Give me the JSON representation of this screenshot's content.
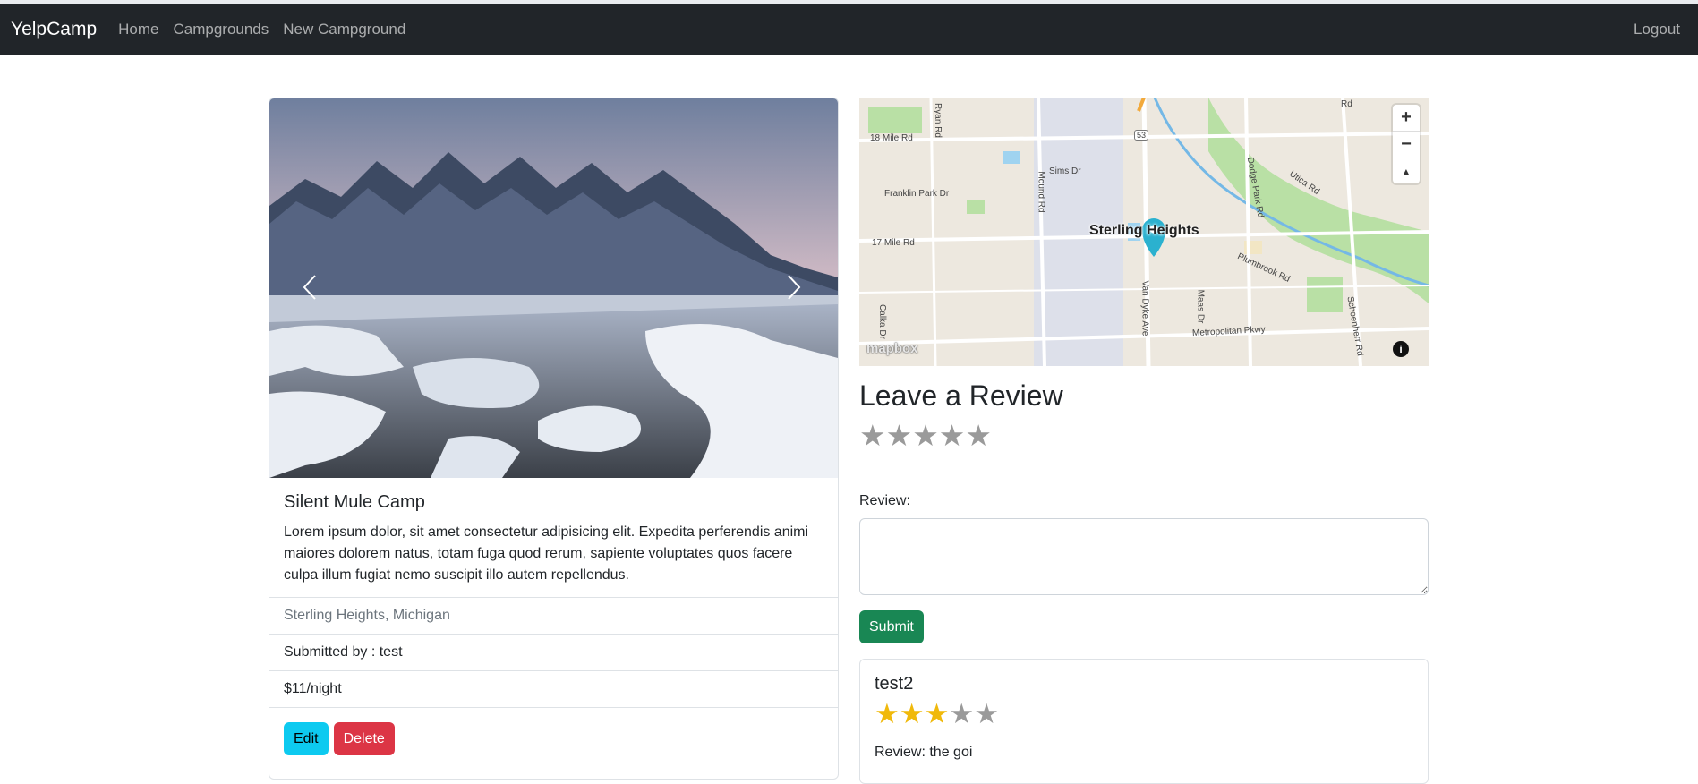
{
  "navbar": {
    "brand": "YelpCamp",
    "links": [
      "Home",
      "Campgrounds",
      "New Campground"
    ],
    "logout": "Logout"
  },
  "campground": {
    "title": "Silent Mule Camp",
    "description": "Lorem ipsum dolor, sit amet consectetur adipisicing elit. Expedita perferendis animi maiores dolorem natus, totam fuga quod rerum, sapiente voluptates quos facere culpa illum fugiat nemo suscipit illo autem repellendus.",
    "location": "Sterling Heights, Michigan",
    "submitted_by": "Submitted by : test",
    "price": "$11/night",
    "edit_label": "Edit",
    "delete_label": "Delete"
  },
  "map": {
    "city": "Sterling Heights",
    "roads": [
      "18 Mile Rd",
      "Ryan Rd",
      "Franklin Park Dr",
      "Sims Dr",
      "17 Mile Rd",
      "Mound Rd",
      "Van Dyke Ave",
      "Dodge Park Rd",
      "Utica Rd",
      "Plumbrook Rd",
      "Metropolitan Pkwy",
      "Schoenherr Rd",
      "Maas Dr",
      "Calka Dr",
      "53",
      "Rd"
    ],
    "logo": "mapbox",
    "zoom_in": "+",
    "zoom_out": "−",
    "compass": "▲",
    "attribution": "i"
  },
  "review_form": {
    "heading": "Leave a Review",
    "stars": [
      "★",
      "★",
      "★",
      "★",
      "★"
    ],
    "label": "Review:",
    "submit_label": "Submit"
  },
  "reviews": [
    {
      "author": "test2",
      "rating": 3,
      "stars": [
        "★",
        "★",
        "★",
        "★",
        "★"
      ],
      "text": "Review: the goi"
    }
  ],
  "colors": {
    "navbar": "#212529",
    "edit": "#0dcaf0",
    "delete": "#dc3545",
    "submit": "#198754",
    "star_on": "#f0b90b",
    "star_off": "#9a9a9a"
  }
}
